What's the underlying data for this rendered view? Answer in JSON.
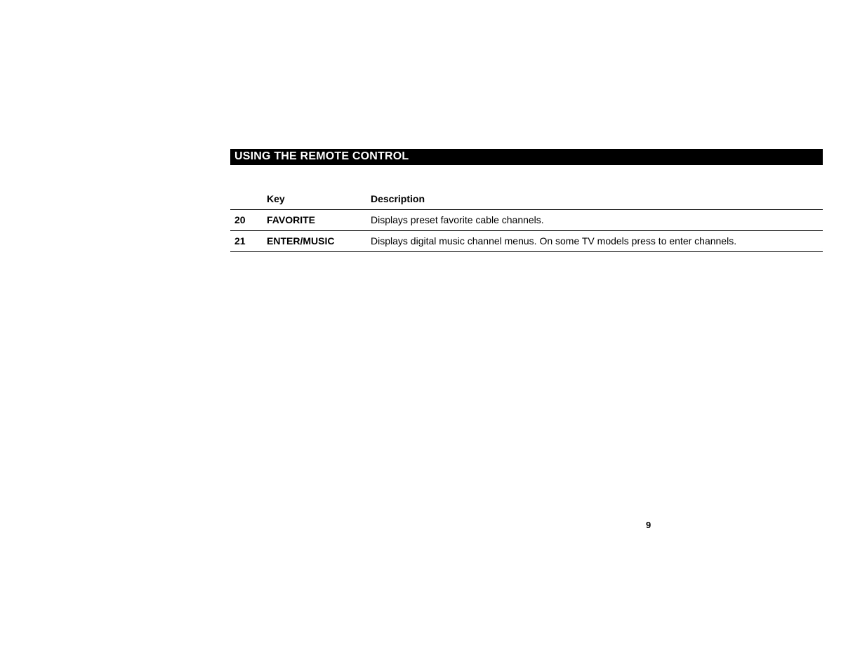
{
  "section_title": "USING THE REMOTE CONTROL",
  "table": {
    "headers": {
      "key": "Key",
      "description": "Description"
    },
    "rows": [
      {
        "num": "20",
        "key": "FAVORITE",
        "desc": "Displays preset favorite cable channels."
      },
      {
        "num": "21",
        "key": "ENTER/MUSIC",
        "desc": "Displays digital music channel menus. On some TV models press to enter channels."
      }
    ]
  },
  "page_number": "9"
}
